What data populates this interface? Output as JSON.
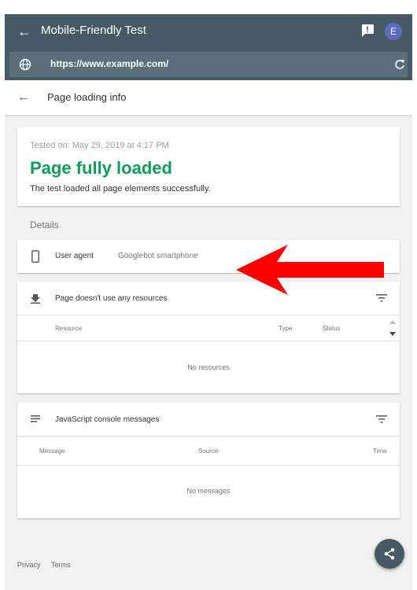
{
  "app": {
    "title": "Mobile-Friendly Test",
    "avatar_initial": "E",
    "url": "https://www.example.com/"
  },
  "subheader": {
    "title": "Page loading info"
  },
  "summary": {
    "tested_on": "Tested on: May 29, 2019 at 4:17 PM",
    "status": "Page fully loaded",
    "description": "The test loaded all page elements successfully.",
    "status_color": "#0f9d58"
  },
  "details": {
    "title": "Details",
    "user_agent_label": "User agent",
    "user_agent_value": "Googlebot smartphone"
  },
  "resources": {
    "title": "Page doesn't use any resources",
    "columns": [
      "Resource",
      "Type",
      "Status"
    ],
    "empty": "No resources"
  },
  "console": {
    "title": "JavaScript console messages",
    "columns": [
      "Message",
      "Source",
      "Time"
    ],
    "empty": "No messages"
  },
  "footer": {
    "privacy": "Privacy",
    "terms": "Terms"
  },
  "colors": {
    "appbar": "#455a64",
    "accent": "#5c6bc0",
    "annotation_arrow": "#ff0000"
  }
}
